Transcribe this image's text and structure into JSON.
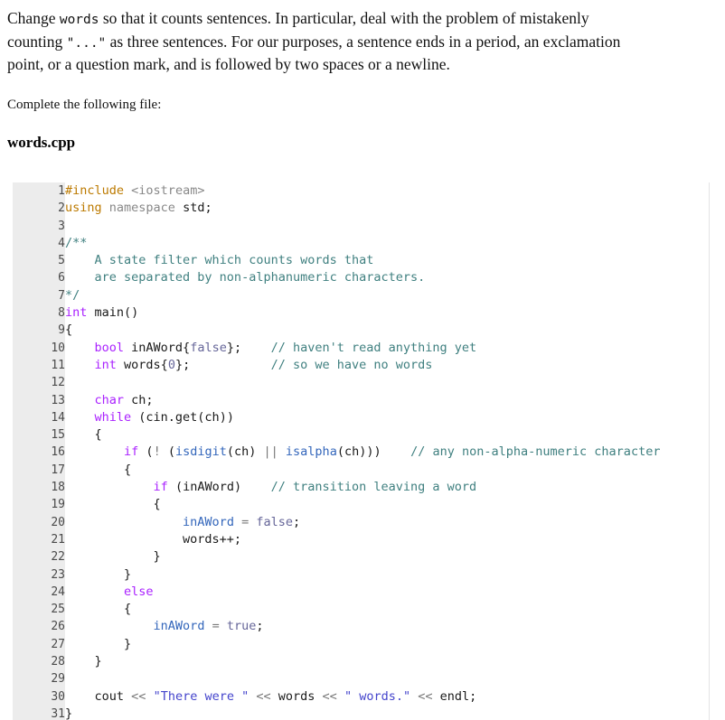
{
  "colors": {
    "gutter_bg": "#ececec",
    "gutter_fg": "#4a4a4a",
    "border": "#e3e3e5",
    "keyword": "#aa22ff",
    "preprocessor": "#bc22aa",
    "header": "#888888",
    "comment": "#408080",
    "number": "#666699",
    "string": "#4444cc",
    "operator": "#777777",
    "function": "#3366bb",
    "text": "#1a1a1a"
  },
  "prose": {
    "intro_parts": [
      {
        "type": "text",
        "value": "Change "
      },
      {
        "type": "code",
        "value": "words"
      },
      {
        "type": "text",
        "value": " so that it counts sentences. In particular, deal with the problem of mistakenly counting "
      },
      {
        "type": "code",
        "value": "\"...\""
      },
      {
        "type": "text",
        "value": " as three sentences. For our purposes, a sentence ends in a period, an exclamation point, or a question mark, and is followed by two spaces or a newline."
      }
    ],
    "intro_text_1": "Change ",
    "intro_code_1": "words",
    "intro_text_2": " so that it counts sentences. In particular, deal with the problem of mistakenly counting ",
    "intro_code_2": "\"...\"",
    "intro_text_3": " as three sentences. For our purposes, a sentence ends in a period, an exclamation point, or a question mark, and is followed by two spaces or a newline.",
    "complete_label": "Complete the following file:",
    "filename": "words.cpp"
  },
  "code": {
    "language": "cpp",
    "first_line_number": 1,
    "last_line_number": 31,
    "line_numbers": [
      "1",
      "2",
      "3",
      "4",
      "5",
      "6",
      "7",
      "8",
      "9",
      "10",
      "11",
      "12",
      "13",
      "14",
      "15",
      "16",
      "17",
      "18",
      "19",
      "20",
      "21",
      "22",
      "23",
      "24",
      "25",
      "26",
      "27",
      "28",
      "29",
      "30",
      "31"
    ],
    "lines": [
      {
        "n": 1,
        "text": "#include <iostream>"
      },
      {
        "n": 2,
        "text": "using namespace std;"
      },
      {
        "n": 3,
        "text": ""
      },
      {
        "n": 4,
        "text": "/**"
      },
      {
        "n": 5,
        "text": "    A state filter which counts words that"
      },
      {
        "n": 6,
        "text": "    are separated by non-alphanumeric characters."
      },
      {
        "n": 7,
        "text": "*/"
      },
      {
        "n": 8,
        "text": "int main()"
      },
      {
        "n": 9,
        "text": "{"
      },
      {
        "n": 10,
        "text": "    bool inAWord{false};    // haven't read anything yet"
      },
      {
        "n": 11,
        "text": "    int words{0};           // so we have no words"
      },
      {
        "n": 12,
        "text": ""
      },
      {
        "n": 13,
        "text": "    char ch;"
      },
      {
        "n": 14,
        "text": "    while (cin.get(ch))"
      },
      {
        "n": 15,
        "text": "    {"
      },
      {
        "n": 16,
        "text": "        if (! (isdigit(ch) || isalpha(ch)))    // any non-alpha-numeric character"
      },
      {
        "n": 17,
        "text": "        {"
      },
      {
        "n": 18,
        "text": "            if (inAWord)    // transition leaving a word"
      },
      {
        "n": 19,
        "text": "            {"
      },
      {
        "n": 20,
        "text": "                inAWord = false;"
      },
      {
        "n": 21,
        "text": "                words++;"
      },
      {
        "n": 22,
        "text": "            }"
      },
      {
        "n": 23,
        "text": "        }"
      },
      {
        "n": 24,
        "text": "        else"
      },
      {
        "n": 25,
        "text": "        {"
      },
      {
        "n": 26,
        "text": "            inAWord = true;"
      },
      {
        "n": 27,
        "text": "        }"
      },
      {
        "n": 28,
        "text": "    }"
      },
      {
        "n": 29,
        "text": ""
      },
      {
        "n": 30,
        "text": "    cout << \"There were \" << words << \" words.\" << endl;"
      },
      {
        "n": 31,
        "text": "}"
      }
    ],
    "tokens": [
      [
        {
          "c": "t-pre",
          "s": "#include"
        },
        {
          "c": "t-plain",
          "s": " "
        },
        {
          "c": "t-hdr",
          "s": "<iostream>"
        }
      ],
      [
        {
          "c": "t-pre",
          "s": "using"
        },
        {
          "c": "t-plain",
          "s": " "
        },
        {
          "c": "t-hdr",
          "s": "namespace"
        },
        {
          "c": "t-plain",
          "s": " std;"
        }
      ],
      [],
      [
        {
          "c": "t-cmt",
          "s": "/**"
        }
      ],
      [
        {
          "c": "t-cmt",
          "s": "    A state filter which counts words that"
        }
      ],
      [
        {
          "c": "t-cmt",
          "s": "    are separated by non-alphanumeric characters."
        }
      ],
      [
        {
          "c": "t-cmt",
          "s": "*/"
        }
      ],
      [
        {
          "c": "t-kw",
          "s": "int"
        },
        {
          "c": "t-plain",
          "s": " main()"
        }
      ],
      [
        {
          "c": "t-plain",
          "s": "{"
        }
      ],
      [
        {
          "c": "t-plain",
          "s": "    "
        },
        {
          "c": "t-kw",
          "s": "bool"
        },
        {
          "c": "t-plain",
          "s": " inAWord{"
        },
        {
          "c": "t-num",
          "s": "false"
        },
        {
          "c": "t-plain",
          "s": "};    "
        },
        {
          "c": "t-cmt",
          "s": "// haven't read anything yet"
        }
      ],
      [
        {
          "c": "t-plain",
          "s": "    "
        },
        {
          "c": "t-kw",
          "s": "int"
        },
        {
          "c": "t-plain",
          "s": " words{"
        },
        {
          "c": "t-num",
          "s": "0"
        },
        {
          "c": "t-plain",
          "s": "};           "
        },
        {
          "c": "t-cmt",
          "s": "// so we have no words"
        }
      ],
      [],
      [
        {
          "c": "t-plain",
          "s": "    "
        },
        {
          "c": "t-kw",
          "s": "char"
        },
        {
          "c": "t-plain",
          "s": " ch;"
        }
      ],
      [
        {
          "c": "t-plain",
          "s": "    "
        },
        {
          "c": "t-kw",
          "s": "while"
        },
        {
          "c": "t-plain",
          "s": " (cin.get(ch))"
        }
      ],
      [
        {
          "c": "t-plain",
          "s": "    {"
        }
      ],
      [
        {
          "c": "t-plain",
          "s": "        "
        },
        {
          "c": "t-kw",
          "s": "if"
        },
        {
          "c": "t-plain",
          "s": " ("
        },
        {
          "c": "t-op",
          "s": "!"
        },
        {
          "c": "t-plain",
          "s": " ("
        },
        {
          "c": "t-fn",
          "s": "isdigit"
        },
        {
          "c": "t-plain",
          "s": "(ch) "
        },
        {
          "c": "t-op",
          "s": "||"
        },
        {
          "c": "t-plain",
          "s": " "
        },
        {
          "c": "t-fn",
          "s": "isalpha"
        },
        {
          "c": "t-plain",
          "s": "(ch)))    "
        },
        {
          "c": "t-cmt",
          "s": "// any non-alpha-numeric character"
        }
      ],
      [
        {
          "c": "t-plain",
          "s": "        {"
        }
      ],
      [
        {
          "c": "t-plain",
          "s": "            "
        },
        {
          "c": "t-kw",
          "s": "if"
        },
        {
          "c": "t-plain",
          "s": " (inAWord)    "
        },
        {
          "c": "t-cmt",
          "s": "// transition leaving a word"
        }
      ],
      [
        {
          "c": "t-plain",
          "s": "            {"
        }
      ],
      [
        {
          "c": "t-plain",
          "s": "                "
        },
        {
          "c": "t-fn",
          "s": "inAWord"
        },
        {
          "c": "t-plain",
          "s": " "
        },
        {
          "c": "t-op",
          "s": "="
        },
        {
          "c": "t-plain",
          "s": " "
        },
        {
          "c": "t-num",
          "s": "false"
        },
        {
          "c": "t-plain",
          "s": ";"
        }
      ],
      [
        {
          "c": "t-plain",
          "s": "                words++;"
        }
      ],
      [
        {
          "c": "t-plain",
          "s": "            }"
        }
      ],
      [
        {
          "c": "t-plain",
          "s": "        }"
        }
      ],
      [
        {
          "c": "t-plain",
          "s": "        "
        },
        {
          "c": "t-kw",
          "s": "else"
        }
      ],
      [
        {
          "c": "t-plain",
          "s": "        {"
        }
      ],
      [
        {
          "c": "t-plain",
          "s": "            "
        },
        {
          "c": "t-fn",
          "s": "inAWord"
        },
        {
          "c": "t-plain",
          "s": " "
        },
        {
          "c": "t-op",
          "s": "="
        },
        {
          "c": "t-plain",
          "s": " "
        },
        {
          "c": "t-num",
          "s": "true"
        },
        {
          "c": "t-plain",
          "s": ";"
        }
      ],
      [
        {
          "c": "t-plain",
          "s": "        }"
        }
      ],
      [
        {
          "c": "t-plain",
          "s": "    }"
        }
      ],
      [],
      [
        {
          "c": "t-plain",
          "s": "    cout "
        },
        {
          "c": "t-op",
          "s": "<<"
        },
        {
          "c": "t-plain",
          "s": " "
        },
        {
          "c": "t-str",
          "s": "\"There were \""
        },
        {
          "c": "t-plain",
          "s": " "
        },
        {
          "c": "t-op",
          "s": "<<"
        },
        {
          "c": "t-plain",
          "s": " words "
        },
        {
          "c": "t-op",
          "s": "<<"
        },
        {
          "c": "t-plain",
          "s": " "
        },
        {
          "c": "t-str",
          "s": "\" words.\""
        },
        {
          "c": "t-plain",
          "s": " "
        },
        {
          "c": "t-op",
          "s": "<<"
        },
        {
          "c": "t-plain",
          "s": " endl;"
        }
      ],
      [
        {
          "c": "t-plain",
          "s": "}"
        }
      ]
    ]
  }
}
